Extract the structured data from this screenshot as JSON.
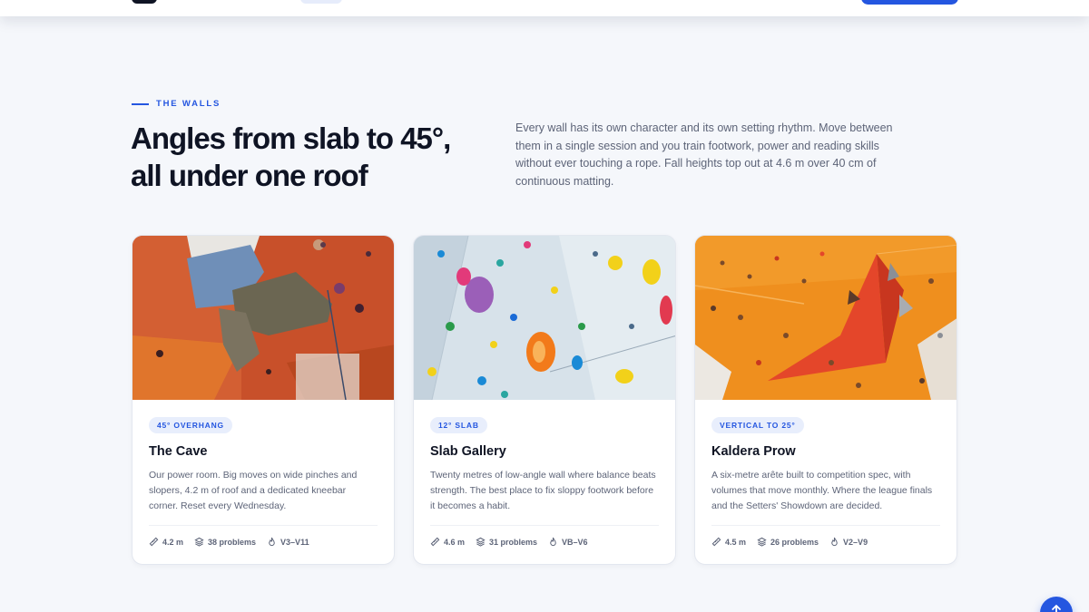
{
  "section": {
    "eyebrow": "THE WALLS",
    "heading_line1": "Angles from slab to 45°,",
    "heading_line2": "all under one roof",
    "intro": "Every wall has its own character and its own setting rhythm. Move between them in a single session and you train footwork, power and reading skills without ever touching a rope. Fall heights top out at 4.6 m over 40 cm of continuous matting."
  },
  "cards": [
    {
      "badge": "45° OVERHANG",
      "title": "The Cave",
      "description": "Our power room. Big moves on wide pinches and slopers, 4.2 m of roof and a dedicated kneebar corner. Reset every Wednesday.",
      "height": "4.2 m",
      "problems": "38 problems",
      "grades": "V3–V11"
    },
    {
      "badge": "12° SLAB",
      "title": "Slab Gallery",
      "description": "Twenty metres of low-angle wall where balance beats strength. The best place to fix sloppy footwork before it becomes a habit.",
      "height": "4.6 m",
      "problems": "31 problems",
      "grades": "VB–V6"
    },
    {
      "badge": "VERTICAL TO 25°",
      "title": "Kaldera Prow",
      "description": "A six-metre arête built to competition spec, with volumes that move monthly. Where the league finals and the Setters' Showdown are decided.",
      "height": "4.5 m",
      "problems": "26 problems",
      "grades": "V2–V9"
    }
  ],
  "icons": {
    "height": "ruler-icon",
    "problems": "layers-icon",
    "grades": "flame-icon",
    "back_to_top": "arrow-up-icon"
  },
  "colors": {
    "accent": "#2456e0",
    "ink": "#0f1424",
    "muted": "#5d6478",
    "background": "#f5f7fb"
  }
}
